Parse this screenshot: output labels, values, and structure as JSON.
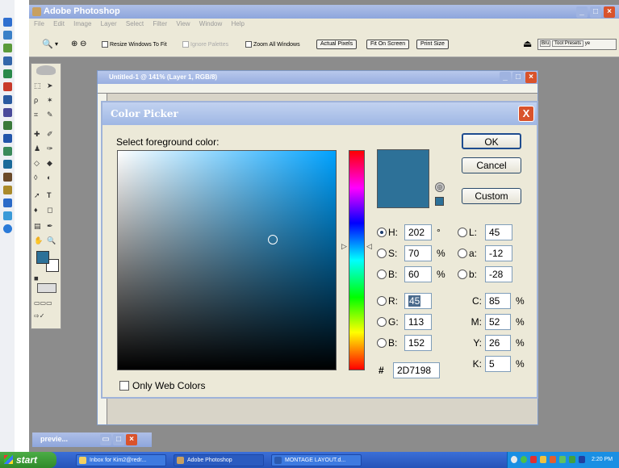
{
  "app": {
    "title": "Adobe Photoshop"
  },
  "menu": [
    "File",
    "Edit",
    "Image",
    "Layer",
    "Select",
    "Filter",
    "View",
    "Window",
    "Help"
  ],
  "options": {
    "resize_label": "Resize Windows To Fit",
    "ignore_label": "Ignore Palettes",
    "zoom_all_label": "Zoom All Windows",
    "actual_pixels": "Actual Pixels",
    "fit_on_screen": "Fit On Screen",
    "print_size": "Print Size",
    "tab_brushes": "Bru",
    "tab_presets": "Tool Presets",
    "tab_layers": "ye"
  },
  "document": {
    "title": "Untitled-1 @ 141% (Layer 1, RGB/8)"
  },
  "preview": {
    "title": "previe..."
  },
  "dialog": {
    "title": "Color Picker",
    "close": "X",
    "select_label": "Select foreground color:",
    "web_colors_label": "Only Web Colors",
    "ok": "OK",
    "cancel": "Cancel",
    "custom": "Custom",
    "current_color": "#2d7198",
    "hsb": {
      "h": {
        "label": "H:",
        "value": "202",
        "unit": "°"
      },
      "s": {
        "label": "S:",
        "value": "70",
        "unit": "%"
      },
      "b": {
        "label": "B:",
        "value": "60",
        "unit": "%"
      }
    },
    "rgb": {
      "r": {
        "label": "R:",
        "value": "45"
      },
      "g": {
        "label": "G:",
        "value": "113"
      },
      "b": {
        "label": "B:",
        "value": "152"
      }
    },
    "lab": {
      "l": {
        "label": "L:",
        "value": "45"
      },
      "a": {
        "label": "a:",
        "value": "-12"
      },
      "b": {
        "label": "b:",
        "value": "-28"
      }
    },
    "cmyk": {
      "c": {
        "label": "C:",
        "value": "85",
        "unit": "%"
      },
      "m": {
        "label": "M:",
        "value": "52",
        "unit": "%"
      },
      "y": {
        "label": "Y:",
        "value": "26",
        "unit": "%"
      },
      "k": {
        "label": "K:",
        "value": "5",
        "unit": "%"
      }
    },
    "hex": {
      "label": "#",
      "value": "2D7198"
    }
  },
  "taskbar": {
    "start": "start",
    "tasks": [
      "Inbox for Kim2@redr...",
      "Adobe Photoshop",
      "MONTAGE LAYOUT.d..."
    ],
    "clock": "2:20 PM"
  }
}
